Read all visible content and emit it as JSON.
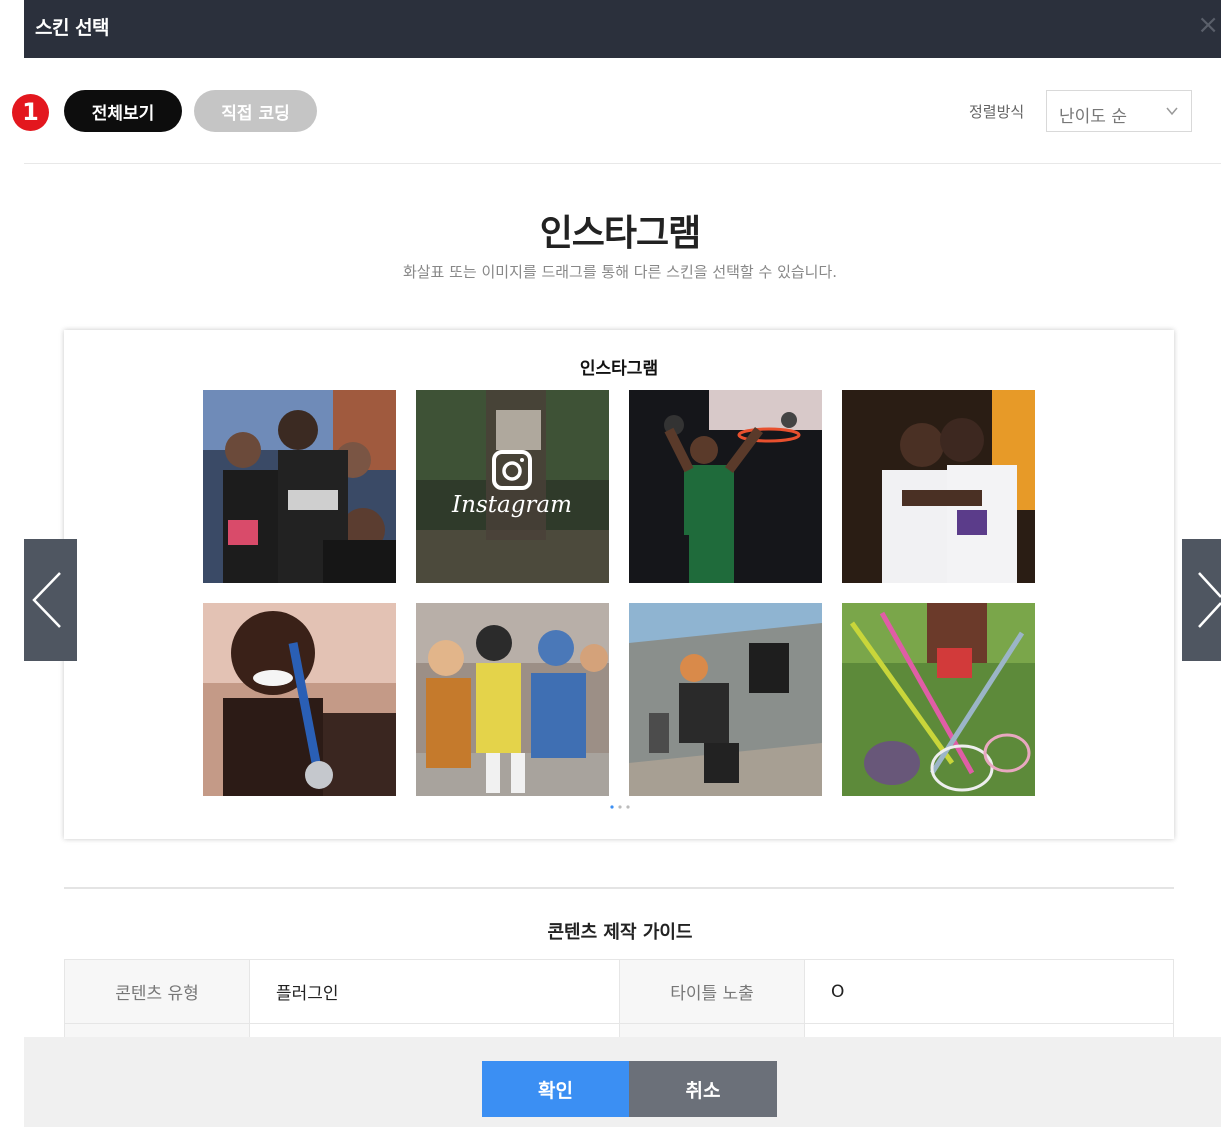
{
  "dialog": {
    "title": "스킨 선택",
    "close_symbol": "×"
  },
  "step_badge": "1",
  "filters": {
    "all_label": "전체보기",
    "code_label": "직접 코딩"
  },
  "sort": {
    "label": "정렬방식",
    "selected": "난이도 순"
  },
  "skin": {
    "title": "인스타그램",
    "description": "화살표 또는 이미지를 드래그를 통해 다른 스킨을 선택할 수 있습니다.",
    "preview_title": "인스타그램",
    "overlay_logo_text": "Instagram",
    "photos": [
      "runners-group-photo",
      "instagram-logo-forest-runner",
      "basketball-dunk-photo",
      "basketball-players-hug-photo",
      "athlete-with-medal-photo",
      "friends-skateboard-photo",
      "breakdancer-photo",
      "lacrosse-sticks-photo"
    ]
  },
  "guide": {
    "title": "콘텐츠 제작 가이드",
    "rows": [
      {
        "label1": "콘텐츠 유형",
        "value1": "플러그인",
        "label2": "타이틀 노출",
        "value2": "O"
      },
      {
        "label1": "",
        "value1": "",
        "label2": "",
        "value2": ""
      }
    ]
  },
  "buttons": {
    "confirm": "확인",
    "cancel": "취소"
  },
  "colors": {
    "titlebar": "#2b303c",
    "confirm": "#3b8ff3",
    "cancel": "#6b7079",
    "badge": "#e3171e"
  }
}
